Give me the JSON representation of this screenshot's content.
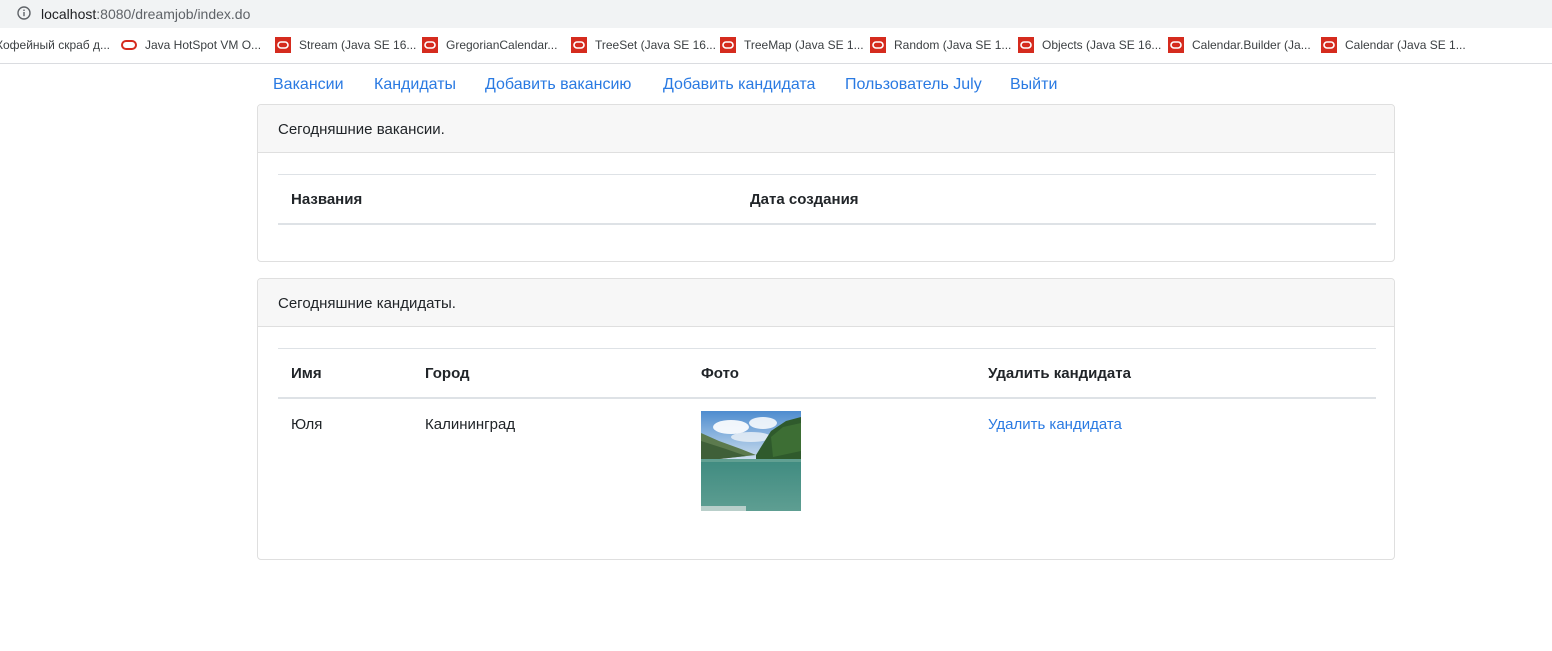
{
  "browser": {
    "url_host": "localhost",
    "url_rest": ":8080/dreamjob/index.do",
    "bookmarks": [
      {
        "label": "Кофейный скраб д...",
        "icon": "none"
      },
      {
        "label": "Java HotSpot VM O...",
        "icon": "oracle-ring"
      },
      {
        "label": "Stream (Java SE 16...",
        "icon": "oracle-box"
      },
      {
        "label": "GregorianCalendar...",
        "icon": "oracle-box"
      },
      {
        "label": "TreeSet (Java SE 16...",
        "icon": "oracle-box"
      },
      {
        "label": "TreeMap (Java SE 1...",
        "icon": "oracle-box"
      },
      {
        "label": "Random (Java SE 1...",
        "icon": "oracle-box"
      },
      {
        "label": "Objects (Java SE 16...",
        "icon": "oracle-box"
      },
      {
        "label": "Calendar.Builder (Ja...",
        "icon": "oracle-box"
      },
      {
        "label": "Calendar (Java SE 1...",
        "icon": "oracle-box"
      }
    ]
  },
  "nav": {
    "items": [
      "Вакансии",
      "Кандидаты",
      "Добавить вакансию",
      "Добавить кандидата",
      "Пользователь July",
      "Выйти"
    ]
  },
  "vacancies": {
    "header": "Сегодняшние вакансии.",
    "columns": [
      "Названия",
      "Дата создания"
    ],
    "rows": []
  },
  "candidates": {
    "header": "Сегодняшние кандидаты.",
    "columns": [
      "Имя",
      "Город",
      "Фото",
      "Удалить кандидата"
    ],
    "rows": [
      {
        "name": "Юля",
        "city": "Калининград",
        "photo": "lake-mountains-photo",
        "delete": "Удалить кандидата"
      }
    ]
  },
  "colors": {
    "link": "#2a7ae2",
    "oracle_red": "#d52b1e",
    "header_bg": "#f7f7f7"
  }
}
